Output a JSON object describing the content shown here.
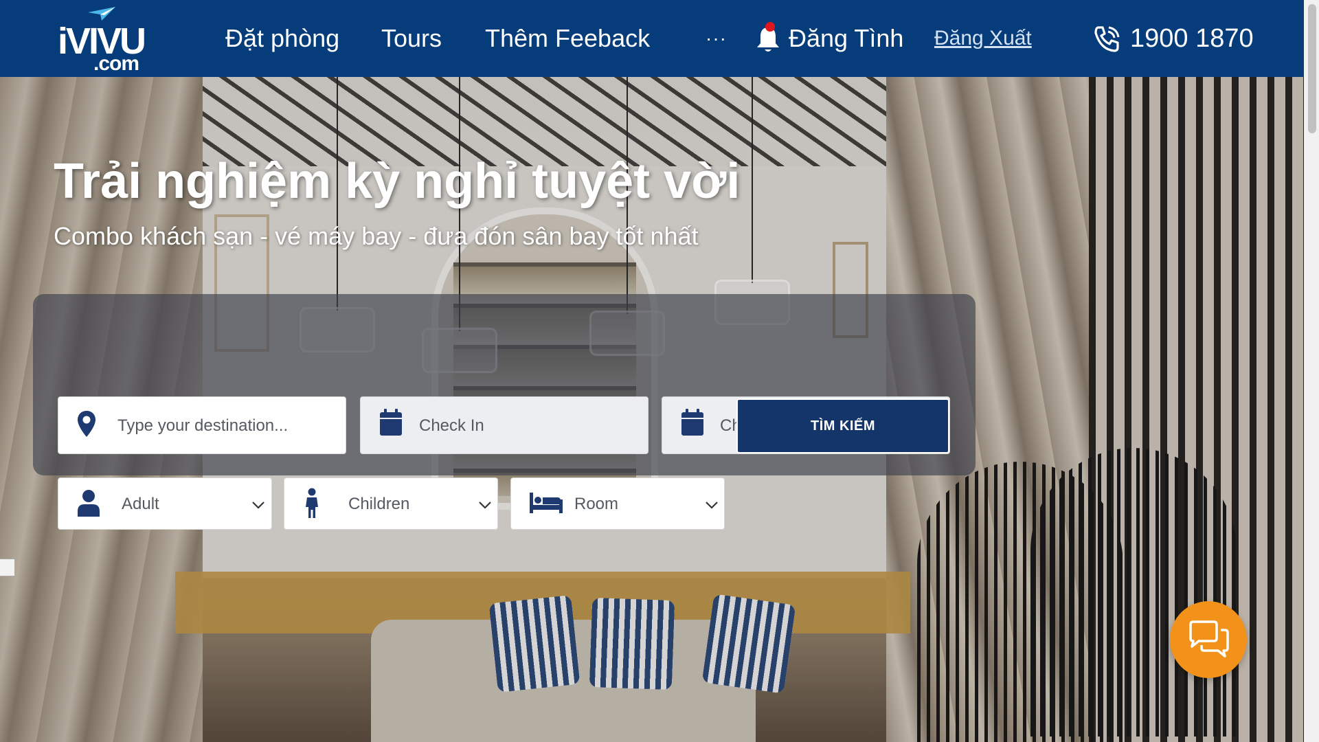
{
  "brand": {
    "logo_main": "iVIVU",
    "logo_domain": ".com"
  },
  "nav": {
    "items": [
      {
        "label": "Đặt phòng"
      },
      {
        "label": "Tours"
      },
      {
        "label": "Thêm Feeback"
      }
    ],
    "more_label": "···",
    "user_name": "Đăng Tình",
    "logout_label": "Đăng Xuất",
    "phone": "1900 1870"
  },
  "hero": {
    "title": "Trải nghiệm kỳ nghỉ tuyệt vời",
    "subtitle": "Combo khách sạn - vé máy bay - đưa đón sân bay tốt nhất"
  },
  "search": {
    "destination_placeholder": "Type your destination...",
    "checkin_placeholder": "Check In",
    "checkout_placeholder": "Check Out",
    "adult_label": "Adult",
    "children_label": "Children",
    "room_label": "Room",
    "search_button": "TÌM KIẾM"
  },
  "colors": {
    "navbar": "#063c7a",
    "icon_blue": "#1e3a70",
    "search_button": "#13356a",
    "chat_button": "#f2921b",
    "notification_dot": "#e0161d"
  },
  "icons": {
    "logo": "ivivu-plane-logo",
    "notification": "bell-icon",
    "phone": "phone-icon",
    "destination": "map-pin-icon",
    "checkin": "calendar-icon",
    "checkout": "calendar-icon",
    "adult": "person-icon",
    "children": "child-icon",
    "room": "bed-icon",
    "chat": "chat-bubbles-icon"
  }
}
